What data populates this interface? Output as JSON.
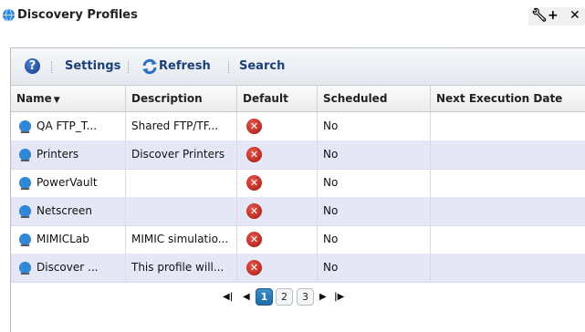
{
  "window": {
    "title": "Discovery Profiles",
    "title_icon": "globe-icon",
    "tools": [
      "wrench-icon",
      "plus-icon",
      "close-icon"
    ]
  },
  "toolbar": {
    "help_icon": "help-icon",
    "help_glyph": "?",
    "settings_label": "Settings",
    "refresh_label": "Refresh",
    "search_label": "Search"
  },
  "table": {
    "columns": [
      "Name",
      "Description",
      "Default",
      "Scheduled",
      "Next Execution Date"
    ],
    "sort_column": "Name",
    "sort_direction": "descending",
    "rows": [
      {
        "name": "QA FTP_T...",
        "description": "Shared FTP/TF...",
        "default": "x-icon",
        "scheduled": "No",
        "next": ""
      },
      {
        "name": "Printers",
        "description": "Discover Printers",
        "default": "x-icon",
        "scheduled": "No",
        "next": ""
      },
      {
        "name": "PowerVault",
        "description": "",
        "default": "x-icon",
        "scheduled": "No",
        "next": ""
      },
      {
        "name": "Netscreen",
        "description": "",
        "default": "x-icon",
        "scheduled": "No",
        "next": ""
      },
      {
        "name": "MIMICLab",
        "description": "MIMIC simulatio...",
        "default": "x-icon",
        "scheduled": "No",
        "next": ""
      },
      {
        "name": "Discover ...",
        "description": "This profile will...",
        "default": "x-icon",
        "scheduled": "No",
        "next": ""
      }
    ]
  },
  "pager": {
    "pages": [
      "1",
      "2",
      "3"
    ],
    "current_page": "1"
  },
  "colors": {
    "accent": "#1c3f78",
    "alt_row": "#e5e7f7",
    "active_page": "#1e6aa5",
    "error_red": "#c0392b"
  }
}
